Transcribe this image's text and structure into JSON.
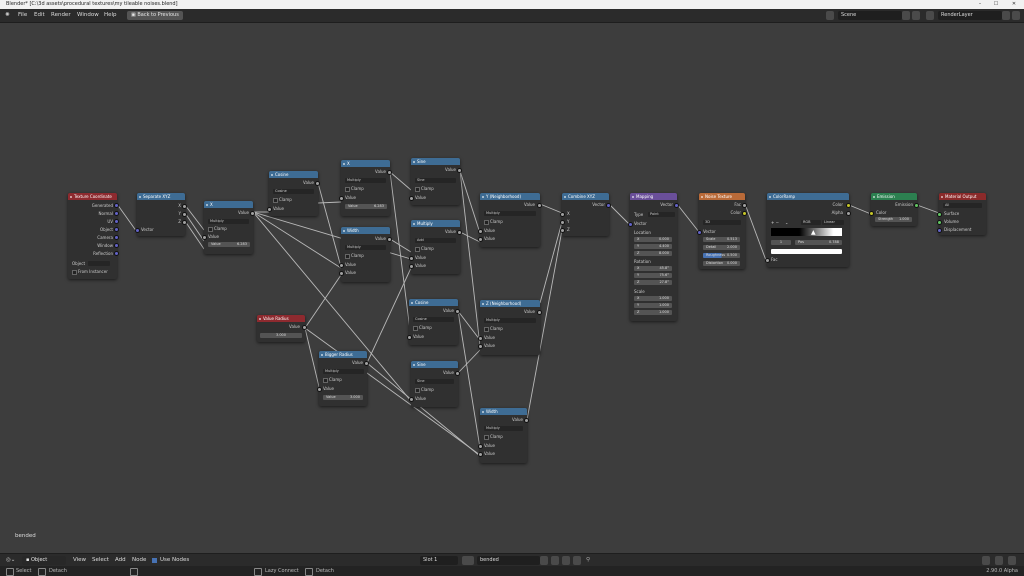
{
  "titlebar": {
    "title": "Blender* [C:\\3d assets\\procedural textures\\my tileable noises.blend]",
    "minimize": "–",
    "maximize": "☐",
    "close": "✕"
  },
  "topbar": {
    "menus": [
      "File",
      "Edit",
      "Render",
      "Window",
      "Help"
    ],
    "back_button": "Back to Previous",
    "scene": "Scene",
    "render_layer": "RenderLayer"
  },
  "nodes": {
    "texcoord": {
      "title": "Texture Coordinate",
      "outputs": [
        "Generated",
        "Normal",
        "UV",
        "Object",
        "Camera",
        "Window",
        "Reflection"
      ],
      "object_label": "Object",
      "from_instancer": "From Instancer"
    },
    "sepxyz": {
      "title": "Separate XYZ",
      "outputs": [
        "X",
        "Y",
        "Z"
      ],
      "input": "Vector"
    },
    "mult1": {
      "title": "X",
      "output": "Value",
      "op": "Multiply",
      "clamp": "Clamp",
      "input": "Value",
      "value_label": "Value",
      "value": "6.283"
    },
    "cos1": {
      "title": "Cosine",
      "output": "Value",
      "op": "Cosine",
      "clamp": "Clamp",
      "input": "Value"
    },
    "multA": {
      "title": "X",
      "output": "Value",
      "op": "Multiply",
      "clamp": "Clamp",
      "input": "Value",
      "value_label": "Value",
      "value": "6.283"
    },
    "multB": {
      "title": "Width",
      "output": "Value",
      "op": "Multiply",
      "clamp": "Clamp",
      "inputs": [
        "Value",
        "Value"
      ]
    },
    "sine1": {
      "title": "Sine",
      "output": "Value",
      "op": "Sine",
      "clamp": "Clamp",
      "input": "Value"
    },
    "add1": {
      "title": "Multiply",
      "output": "Value",
      "op": "Add",
      "clamp": "Clamp",
      "inputs": [
        "Value",
        "Value"
      ]
    },
    "cos2": {
      "title": "Cosine",
      "output": "Value",
      "op": "Cosine",
      "clamp": "Clamp",
      "input": "Value"
    },
    "sine2": {
      "title": "Sine",
      "output": "Value",
      "op": "Sine",
      "clamp": "Clamp",
      "input": "Value"
    },
    "val1": {
      "title": "Value Radius",
      "output": "Value",
      "value": "3.000"
    },
    "mult2": {
      "title": "Bigger Radius",
      "output": "Value",
      "op": "Multiply",
      "clamp": "Clamp",
      "input": "Value",
      "value_label": "Value",
      "value": "3.000"
    },
    "m3": {
      "title": "Y (Neighborhood)",
      "output": "Value",
      "op": "Multiply",
      "clamp": "Clamp",
      "inputs": [
        "Value",
        "Value"
      ]
    },
    "m4": {
      "title": "Z (Neighborhood)",
      "output": "Value",
      "op": "Multiply",
      "clamp": "Clamp",
      "inputs": [
        "Value",
        "Value"
      ]
    },
    "m5": {
      "title": "Width",
      "output": "Value",
      "op": "Multiply",
      "clamp": "Clamp",
      "inputs": [
        "Value",
        "Value"
      ]
    },
    "combxyz": {
      "title": "Combine XYZ",
      "output": "Vector",
      "inputs": [
        "X",
        "Y",
        "Z"
      ]
    },
    "mapping": {
      "title": "Mapping",
      "output": "Vector",
      "type_label": "Type",
      "type": "Point",
      "input": "Vector",
      "location_label": "Location",
      "location": [
        [
          "X",
          "0.000"
        ],
        [
          "Y",
          "4.400"
        ],
        [
          "Z",
          "8.000"
        ]
      ],
      "rotation_label": "Rotation",
      "rotation": [
        [
          "X",
          "45.8°"
        ],
        [
          "Y",
          "75.6°"
        ],
        [
          "Z",
          "27.8°"
        ]
      ],
      "scale_label": "Scale",
      "scale": [
        [
          "X",
          "1.000"
        ],
        [
          "Y",
          "1.000"
        ],
        [
          "Z",
          "1.000"
        ]
      ]
    },
    "noise": {
      "title": "Noise Texture",
      "outputs": [
        "Fac",
        "Color"
      ],
      "dim": "3D",
      "input": "Vector",
      "fields": [
        [
          "Scale",
          "0.513"
        ],
        [
          "Detail",
          "2.000"
        ],
        [
          "Roughness",
          "0.500"
        ],
        [
          "Distortion",
          "0.000"
        ]
      ]
    },
    "ramp": {
      "title": "ColorRamp",
      "outputs": [
        "Color",
        "Alpha"
      ],
      "mode": "RGB",
      "interp": "Linear",
      "pos_index": "1",
      "pos_label": "Pos",
      "pos_value": "0.788",
      "input": "Fac"
    },
    "emission": {
      "title": "Emission",
      "output": "Emission",
      "inputs": [
        "Color"
      ],
      "strength_label": "Strength",
      "strength": "1.000"
    },
    "output": {
      "title": "Material Output",
      "target": "All",
      "inputs": [
        "Surface",
        "Volume",
        "Displacement"
      ]
    }
  },
  "editor_label": "bended",
  "bottombar": {
    "mode": "Object",
    "menus": [
      "View",
      "Select",
      "Add",
      "Node"
    ],
    "use_nodes": "Use Nodes",
    "slot": "Slot 1",
    "material": "bended"
  },
  "statusbar": {
    "items": [
      "Select",
      "Detach",
      "Lazy Connect",
      "Detach"
    ],
    "version": "2.90.0 Alpha"
  },
  "colors": {
    "header_blue": "#3e6c94",
    "header_red": "#8e2a2f",
    "header_purple": "#6a4f9a",
    "header_orange": "#b96a38",
    "header_green": "#2c8050",
    "wire": "#d0d0d0"
  }
}
